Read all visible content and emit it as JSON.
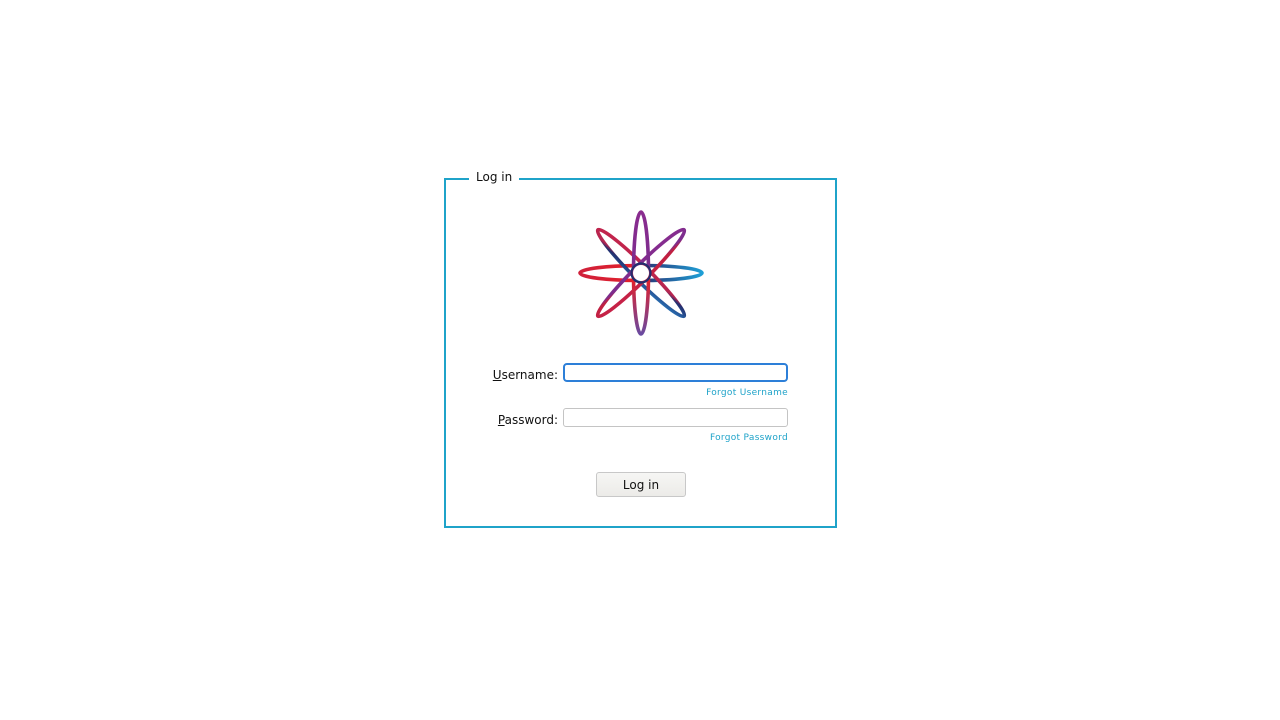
{
  "form": {
    "legend": "Log in",
    "username": {
      "label_accesskey": "U",
      "label_rest": "sername:",
      "value": "",
      "placeholder": "",
      "forgot_link": "Forgot Username"
    },
    "password": {
      "label_accesskey": "P",
      "label_rest": "assword:",
      "value": "",
      "placeholder": "",
      "forgot_link": "Forgot Password"
    },
    "submit_label": "Log in"
  },
  "logo": {
    "icon": "atom-flower-logo-icon"
  },
  "colors": {
    "accent": "#1fa3c9",
    "focus_ring": "#2d7fd8",
    "logo_red": "#e3202a",
    "logo_purple": "#7b2d8e",
    "logo_blue": "#1e9fd6",
    "logo_navy": "#232e6e"
  }
}
